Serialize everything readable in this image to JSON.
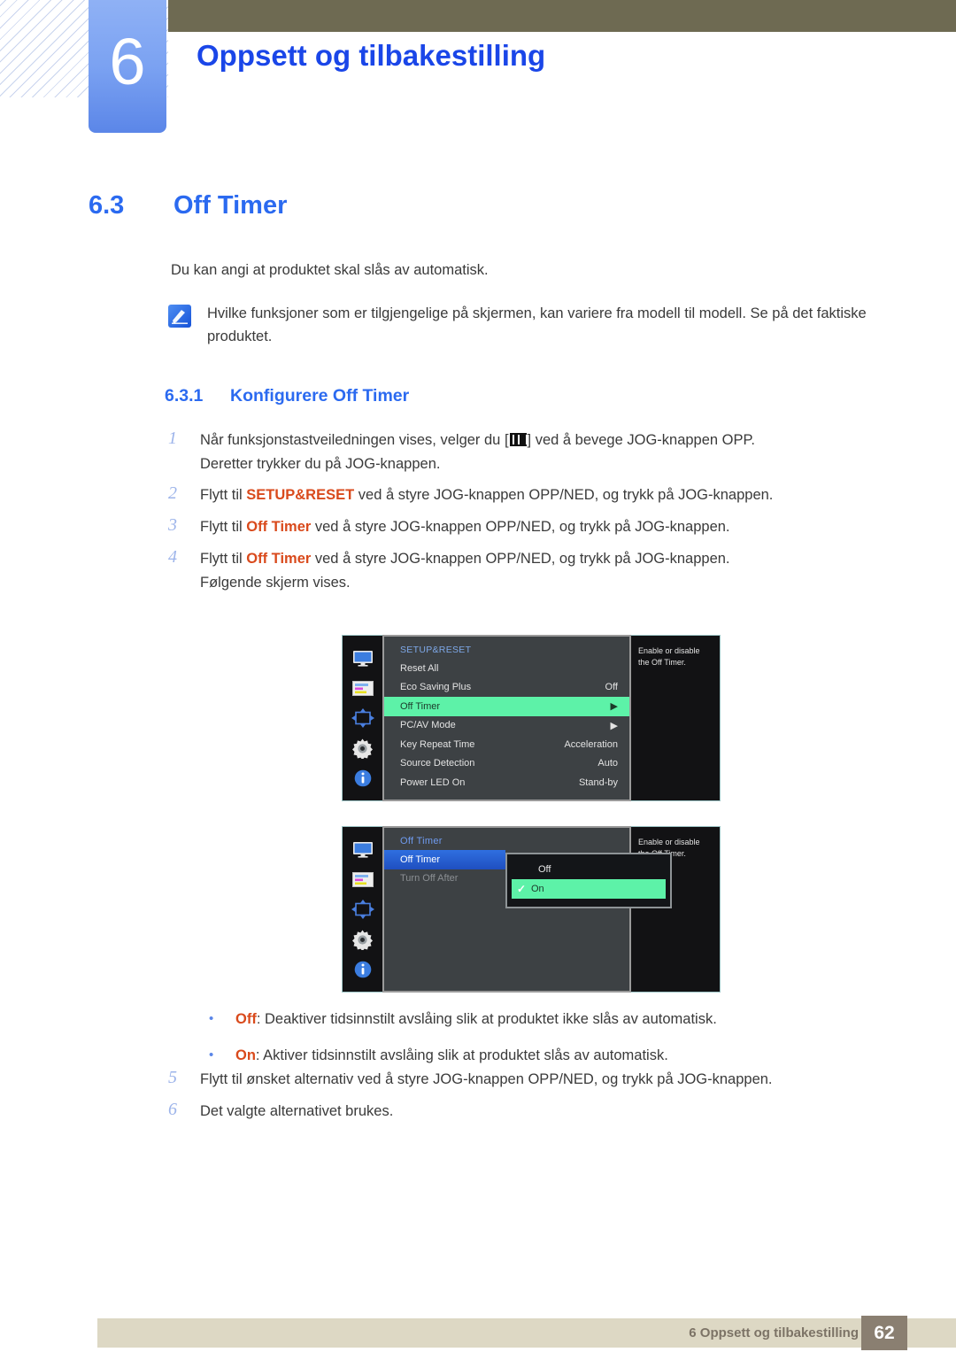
{
  "header": {
    "chapter_number": "6",
    "chapter_title": "Oppsett og tilbakestilling"
  },
  "section": {
    "number": "6.3",
    "title": "Off Timer",
    "intro": "Du kan angi at produktet skal slås av automatisk."
  },
  "note": {
    "icon": "note-pen-icon",
    "text": "Hvilke funksjoner som er tilgjengelige på skjermen, kan variere fra modell til modell. Se på det faktiske produktet."
  },
  "subsection": {
    "number": "6.3.1",
    "title": "Konfigurere Off Timer"
  },
  "steps": [
    {
      "n": "1",
      "pre": "Når funksjonstastveiledningen vises, velger du [",
      "glyph": "menu-icon",
      "post": "] ved å bevege JOG-knappen OPP.",
      "cont": "Deretter trykker du på JOG-knappen."
    },
    {
      "n": "2",
      "pre": "Flytt til ",
      "kw": "SETUP&RESET",
      "post": " ved å styre JOG-knappen OPP/NED, og trykk på JOG-knappen.",
      "cont": ""
    },
    {
      "n": "3",
      "pre": "Flytt til ",
      "kw": "Off Timer",
      "post": " ved å styre JOG-knappen OPP/NED, og trykk på JOG-knappen.",
      "cont": ""
    },
    {
      "n": "4",
      "pre": "Flytt til ",
      "kw": "Off Timer",
      "post": " ved å styre JOG-knappen OPP/NED, og trykk på JOG-knappen.",
      "cont": "Følgende skjerm vises."
    }
  ],
  "osd1": {
    "rail_icons": [
      "monitor-icon",
      "color-sliders-icon",
      "four-way-arrows-icon",
      "gear-icon",
      "info-icon"
    ],
    "header": "SETUP&RESET",
    "rows": [
      {
        "label": "Reset All",
        "value": ""
      },
      {
        "label": "Eco Saving Plus",
        "value": "Off"
      },
      {
        "label": "Off Timer",
        "value": "▶",
        "selected": "green"
      },
      {
        "label": "PC/AV Mode",
        "value": "▶"
      },
      {
        "label": "Key Repeat Time",
        "value": "Acceleration"
      },
      {
        "label": "Source Detection",
        "value": "Auto"
      },
      {
        "label": "Power LED On",
        "value": "Stand-by"
      }
    ],
    "tooltip": "Enable or disable the Off Timer."
  },
  "osd2": {
    "rail_icons": [
      "monitor-icon",
      "color-sliders-icon",
      "four-way-arrows-icon",
      "gear-icon",
      "info-icon"
    ],
    "header": "Off Timer",
    "rows": [
      {
        "label": "Off Timer",
        "selected": "blue"
      },
      {
        "label": "Turn Off After",
        "dim": true
      }
    ],
    "dropdown": [
      {
        "label": "Off",
        "checked": false
      },
      {
        "label": "On",
        "checked": true,
        "check": "✓"
      }
    ],
    "tooltip": "Enable or disable the Off Timer."
  },
  "bullets": [
    {
      "dot": "•",
      "kw": "Off",
      "text": ": Deaktiver tidsinnstilt avslåing slik at produktet ikke slås av automatisk."
    },
    {
      "dot": "•",
      "kw": "On",
      "text": ": Aktiver tidsinnstilt avslåing slik at produktet slås av automatisk."
    }
  ],
  "steps2": [
    {
      "n": "5",
      "pre": "Flytt til ønsket alternativ ved å styre JOG-knappen OPP/NED, og trykk på JOG-knappen."
    },
    {
      "n": "6",
      "pre": "Det valgte alternativet brukes."
    }
  ],
  "footer": {
    "text": "6 Oppsett og tilbakestilling",
    "page": "62"
  },
  "colors": {
    "accent_blue": "#2b6af0",
    "keyword_orange": "#d94a1c",
    "olive": "#6e6a52",
    "footer_bg": "#ddd8c4",
    "page_badge": "#8a7f71",
    "osd_green": "#5df2a8",
    "osd_blue": "#2f6fe0"
  }
}
